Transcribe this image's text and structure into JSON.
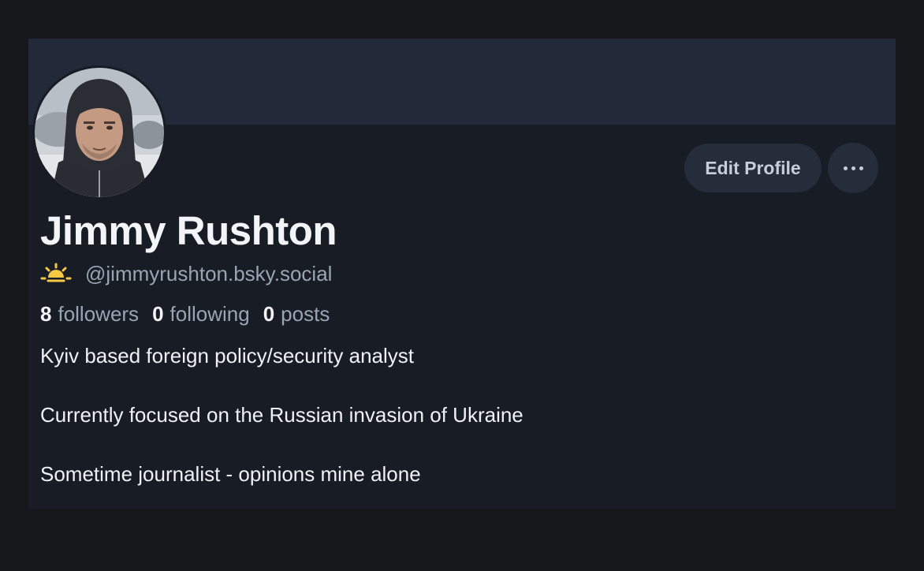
{
  "profile": {
    "display_name": "Jimmy Rushton",
    "handle": "@jimmyrushton.bsky.social",
    "handle_icon": "sunrise-icon",
    "avatar": "profile-photo-avatar",
    "stats": {
      "followers": {
        "count": "8",
        "label": "followers"
      },
      "following": {
        "count": "0",
        "label": "following"
      },
      "posts": {
        "count": "0",
        "label": "posts"
      }
    },
    "bio": [
      "Kyiv based foreign policy/security analyst",
      "Currently focused on the Russian invasion of Ukraine",
      "Sometime journalist - opinions mine alone"
    ]
  },
  "actions": {
    "edit_label": "Edit Profile",
    "more_icon": "more-horizontal-icon"
  },
  "colors": {
    "page_background": "#16171b",
    "card_background": "#181c24",
    "banner": "#222938",
    "button": "#252c3a",
    "text_primary": "#f2f4f7",
    "text_secondary": "#9aa4b3",
    "sun_icon": "#f6c945"
  }
}
